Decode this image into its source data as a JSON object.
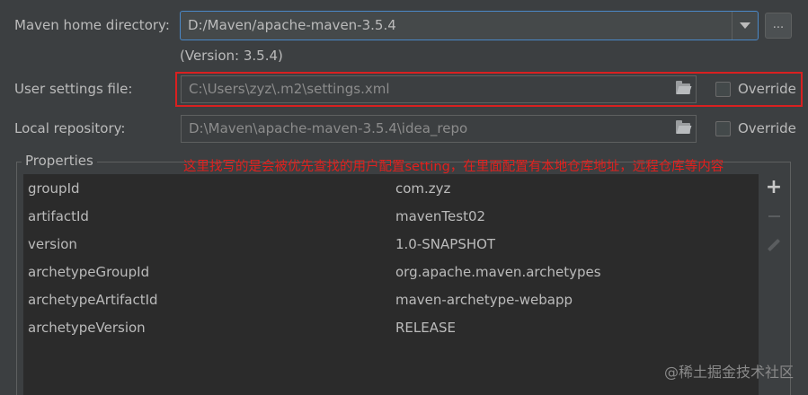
{
  "maven_home": {
    "label": "Maven home directory:",
    "value": "D:/Maven/apache-maven-3.5.4",
    "browse_label": "..."
  },
  "version_text": "(Version: 3.5.4)",
  "user_settings": {
    "label": "User settings file:",
    "value": "C:\\Users\\zyz\\.m2\\settings.xml",
    "override_label": "Override"
  },
  "local_repo": {
    "label": "Local repository:",
    "value": "D:\\Maven\\apache-maven-3.5.4\\idea_repo",
    "override_label": "Override"
  },
  "properties": {
    "title": "Properties",
    "annotation": "这里找写的是会被优先查找的用户配置setting，在里面配置有本地仓库地址，远程仓库等内容",
    "rows": [
      {
        "key": "groupId",
        "value": "com.zyz"
      },
      {
        "key": "artifactId",
        "value": "mavenTest02"
      },
      {
        "key": "version",
        "value": "1.0-SNAPSHOT"
      },
      {
        "key": "archetypeGroupId",
        "value": "org.apache.maven.archetypes"
      },
      {
        "key": "archetypeArtifactId",
        "value": "maven-archetype-webapp"
      },
      {
        "key": "archetypeVersion",
        "value": "RELEASE"
      }
    ],
    "add_icon": "plus-icon",
    "remove_icon": "minus-icon",
    "edit_icon": "pencil-icon"
  },
  "watermark": "@稀土掘金技术社区",
  "colors": {
    "background": "#3c3f41",
    "table_background": "#2b2b2b",
    "focus_border": "#4a88c7",
    "highlight_red": "#d92020"
  }
}
